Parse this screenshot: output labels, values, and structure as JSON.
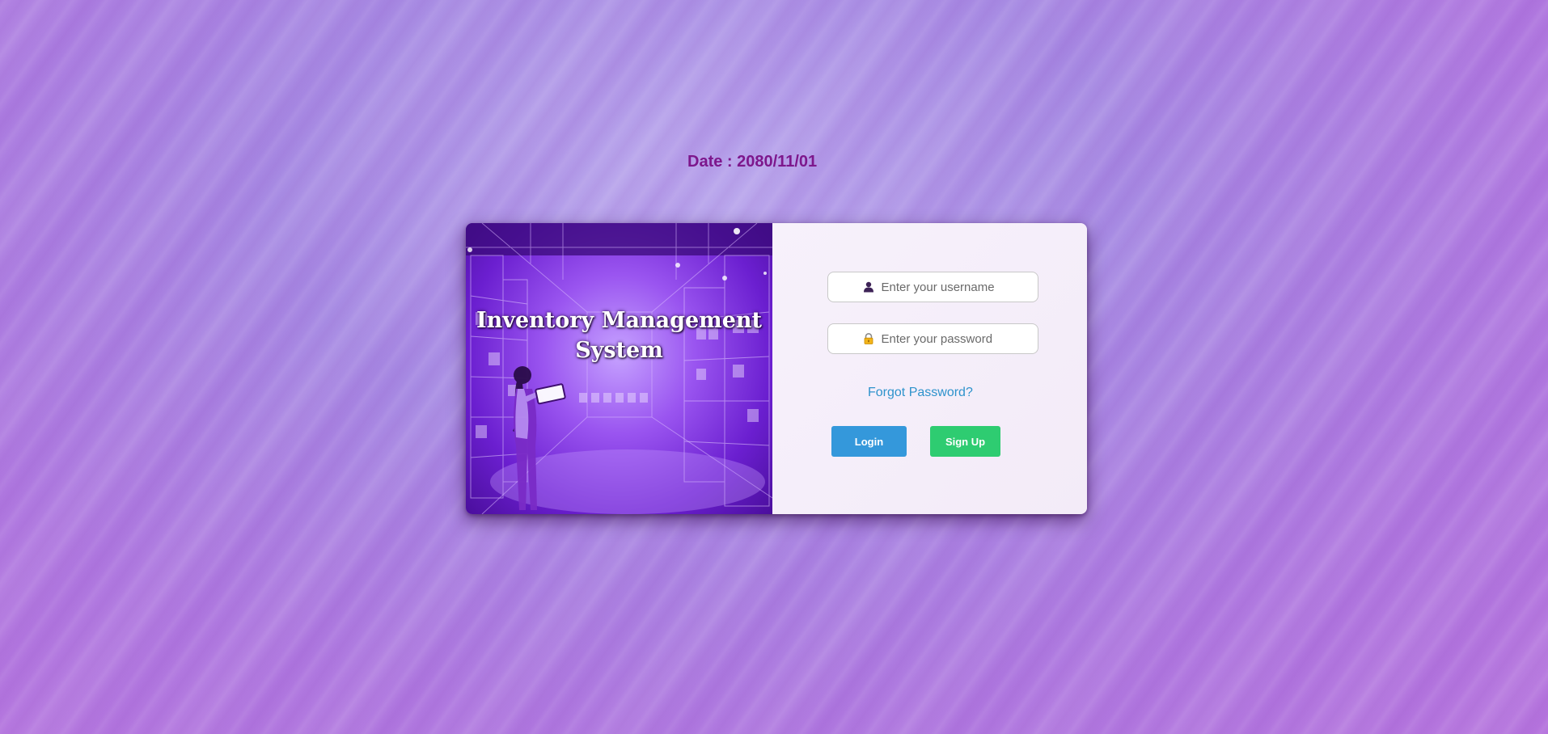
{
  "header": {
    "date_text": "Date : 2080/11/01"
  },
  "hero": {
    "title": "Inventory Management System",
    "illustration": "woman-with-tablet-in-warehouse"
  },
  "login_form": {
    "username": {
      "placeholder": "Enter your username",
      "value": "",
      "icon": "user-icon"
    },
    "password": {
      "placeholder": "Enter your password",
      "value": "",
      "icon": "lock-icon"
    },
    "forgot_password_label": "Forgot Password?",
    "login_label": "Login",
    "signup_label": "Sign Up"
  },
  "colors": {
    "date_text": "#7d178c",
    "link": "#2e93cc",
    "login_button": "#3498db",
    "signup_button": "#2ecc71",
    "panel_background": "#f5eefa"
  }
}
